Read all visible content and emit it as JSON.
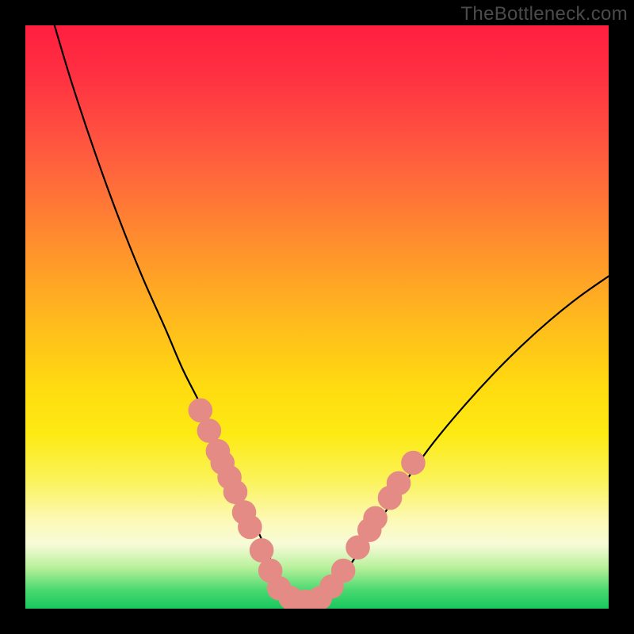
{
  "watermark": "TheBottleneck.com",
  "colors": {
    "curve_stroke": "#000000",
    "marker_fill": "#e58b86",
    "marker_stroke": "#e58b86",
    "gradient_top": "#ff1f3f",
    "gradient_bottom": "#18c85f",
    "frame": "#000000"
  },
  "chart_data": {
    "type": "line",
    "title": "",
    "xlabel": "",
    "ylabel": "",
    "xlim": [
      0,
      100
    ],
    "ylim": [
      0,
      100
    ],
    "note": "Axis tick labels are not rendered in the image; values are in 0–100 plot-space estimated from pixel positions. y=0 is the bottom (green), y=100 is the top (red). The curve is a V-shaped bottleneck profile with its minimum near x≈44–50 at y≈1.",
    "series": [
      {
        "name": "bottleneck-curve",
        "x": [
          5,
          8,
          12,
          16,
          20,
          24,
          27,
          30,
          32,
          34,
          36,
          38,
          40,
          42,
          44,
          46,
          48,
          50,
          52,
          55,
          58,
          62,
          66,
          70,
          75,
          80,
          85,
          90,
          95,
          100
        ],
        "y": [
          100,
          90,
          78,
          67,
          57,
          48,
          41,
          35,
          30,
          25.5,
          21,
          17,
          13,
          8.5,
          4,
          1.6,
          1.0,
          1.2,
          2.8,
          6.5,
          11,
          17,
          23,
          28.5,
          34.5,
          40,
          45,
          49.5,
          53.5,
          57
        ]
      }
    ],
    "markers": {
      "name": "highlighted-points",
      "note": "Salmon circular markers clustered on both limbs of the V near the bottom. Coordinates in same 0–100 plot space.",
      "points": [
        {
          "x": 30.0,
          "y": 34.0
        },
        {
          "x": 31.5,
          "y": 30.5
        },
        {
          "x": 33.0,
          "y": 27.0
        },
        {
          "x": 33.8,
          "y": 25.0
        },
        {
          "x": 35.0,
          "y": 22.5
        },
        {
          "x": 36.0,
          "y": 20.0
        },
        {
          "x": 37.5,
          "y": 16.5
        },
        {
          "x": 38.5,
          "y": 14.0
        },
        {
          "x": 40.5,
          "y": 10.0
        },
        {
          "x": 42.0,
          "y": 6.5
        },
        {
          "x": 43.5,
          "y": 3.5
        },
        {
          "x": 45.5,
          "y": 1.8
        },
        {
          "x": 48.0,
          "y": 1.2
        },
        {
          "x": 50.5,
          "y": 1.8
        },
        {
          "x": 52.5,
          "y": 3.8
        },
        {
          "x": 54.5,
          "y": 6.5
        },
        {
          "x": 57.0,
          "y": 10.5
        },
        {
          "x": 59.0,
          "y": 13.5
        },
        {
          "x": 60.0,
          "y": 15.5
        },
        {
          "x": 62.5,
          "y": 19.0
        },
        {
          "x": 64.0,
          "y": 21.5
        },
        {
          "x": 66.5,
          "y": 25.0
        }
      ],
      "radius": 2.0
    }
  }
}
